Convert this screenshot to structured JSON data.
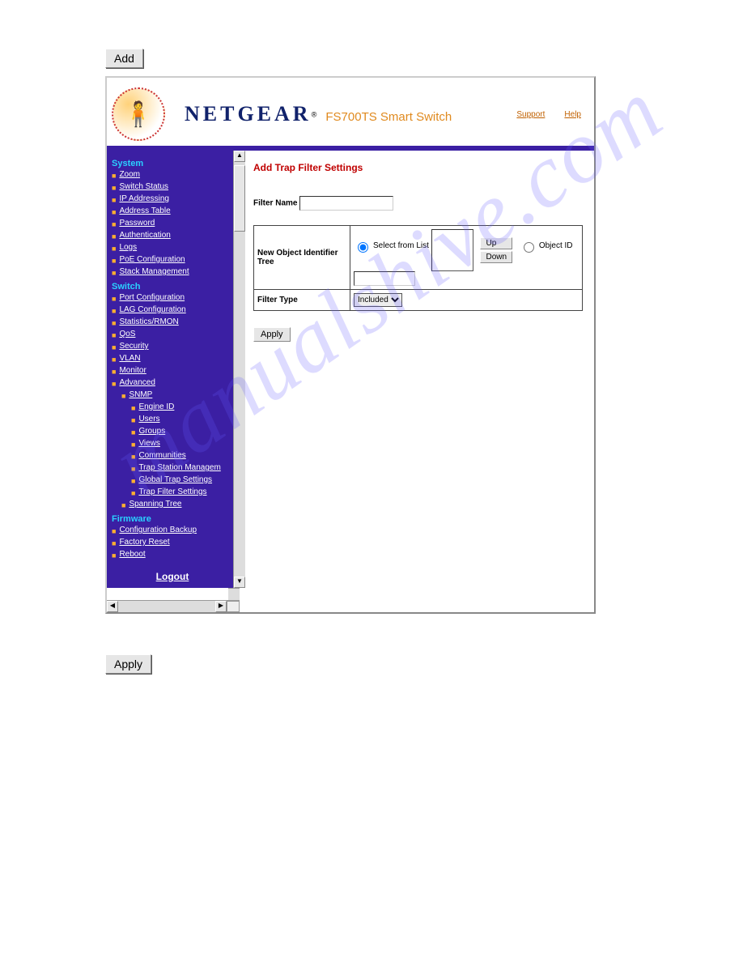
{
  "watermark": "manualshive.com",
  "outer": {
    "add_button": "Add",
    "apply_button": "Apply"
  },
  "header": {
    "brand": "NETGEAR",
    "subtitle": "FS700TS Smart Switch",
    "links": {
      "support": "Support",
      "help": "Help"
    }
  },
  "sidebar": {
    "sections": {
      "system": "System",
      "switch": "Switch",
      "firmware": "Firmware"
    },
    "system_items": [
      "Zoom",
      "Switch Status",
      "IP Addressing",
      "Address Table",
      "Password",
      "Authentication",
      "Logs",
      "PoE Configuration",
      "Stack Management"
    ],
    "switch_items": [
      "Port Configuration",
      "LAG Configuration",
      "Statistics/RMON",
      "QoS",
      "Security",
      "VLAN",
      "Monitor",
      "Advanced"
    ],
    "advanced_sub": [
      "SNMP"
    ],
    "snmp_sub": [
      "Engine ID",
      "Users",
      "Groups",
      "Views",
      "Communities",
      "Trap Station Managem",
      "Global Trap Settings",
      "Trap Filter Settings"
    ],
    "advanced_sub2": [
      "Spanning Tree"
    ],
    "firmware_items": [
      "Configuration Backup",
      "Factory Reset",
      "Reboot"
    ],
    "logout": "Logout"
  },
  "main": {
    "title": "Add Trap Filter Settings",
    "filter_name_label": "Filter Name",
    "filter_name_value": "",
    "row_obj_label": "New Object Identifier Tree",
    "radio_select_label": "Select from List",
    "btn_up": "Up",
    "btn_down": "Down",
    "radio_obj_label": "Object ID",
    "object_id_value": "",
    "filter_type_label": "Filter Type",
    "filter_type_value": "Included",
    "apply": "Apply"
  }
}
